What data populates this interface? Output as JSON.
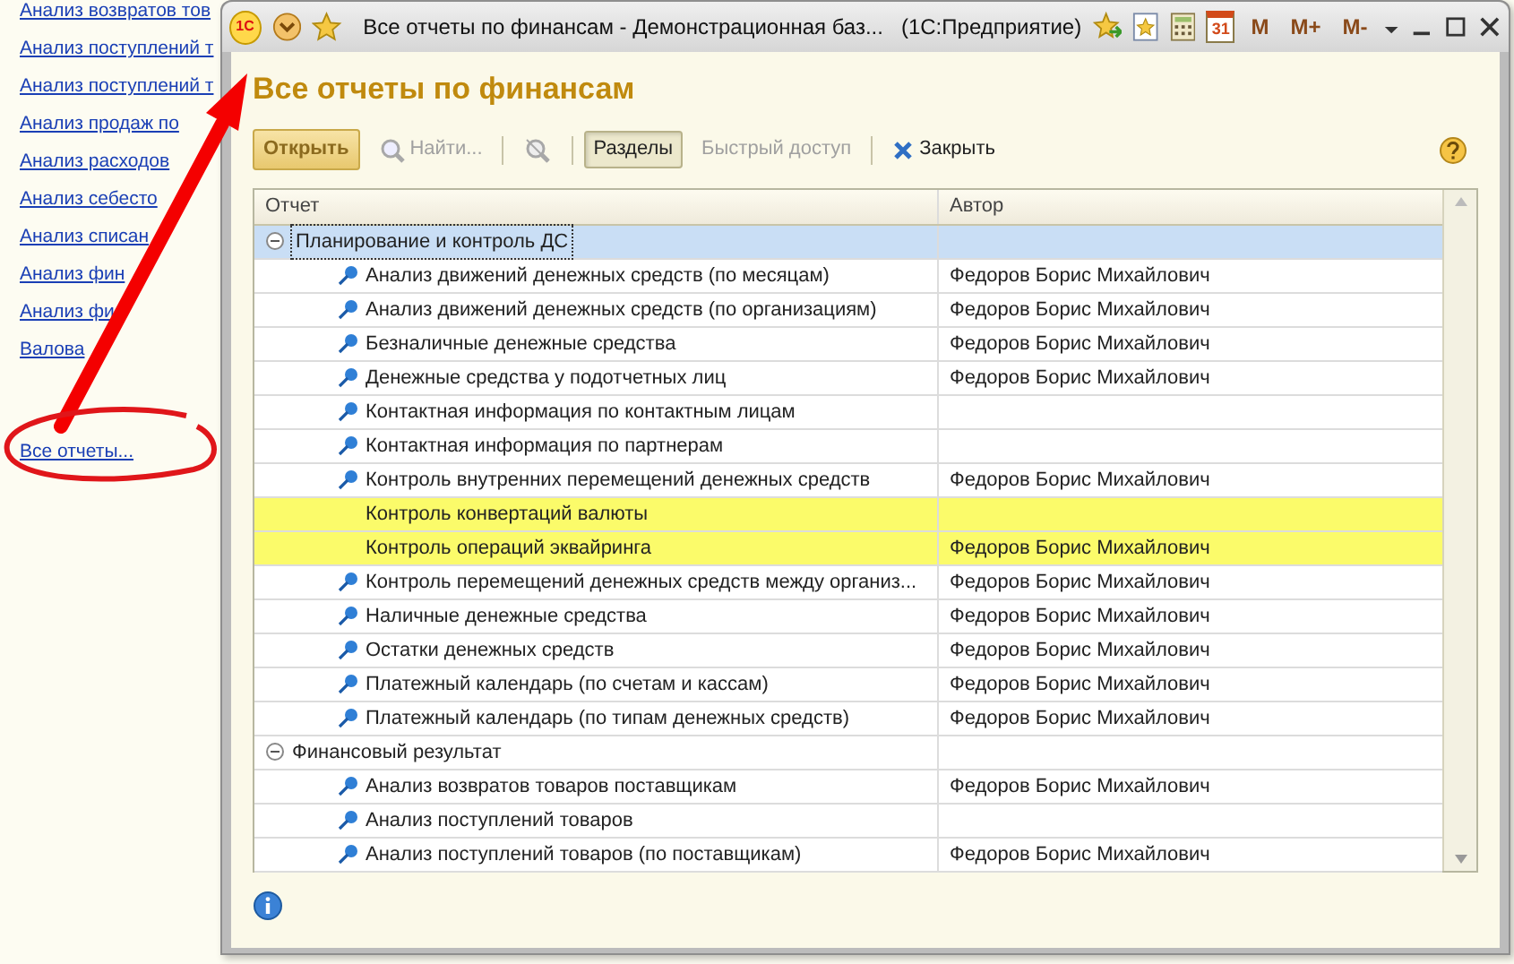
{
  "side_links": [
    {
      "text": "Анализ возвратов тов"
    },
    {
      "text": "Анализ поступлений т"
    },
    {
      "text": "Анализ поступлений т"
    },
    {
      "text": "Анализ продаж по"
    },
    {
      "text": "Анализ расходов"
    },
    {
      "text": "Анализ себесто"
    },
    {
      "text": "Анализ списан"
    },
    {
      "text": "Анализ фин"
    },
    {
      "text": "Анализ фи"
    },
    {
      "text": "Валова"
    }
  ],
  "all_reports_link": "Все отчеты...",
  "window": {
    "logo": "1С",
    "title": "Все отчеты по финансам - Демонстрационная баз...   (1С:Предприятие)",
    "calendar_day": "31",
    "memory_buttons": [
      "M",
      "M+",
      "M-"
    ]
  },
  "heading": "Все отчеты по финансам",
  "toolbar": [
    {
      "kind": "button",
      "label": "Открыть",
      "disabled": false,
      "pressed": false,
      "separator_before": false
    },
    {
      "kind": "find",
      "label": "Найти...",
      "disabled": true,
      "pressed": false,
      "separator_before": false
    },
    {
      "kind": "clear",
      "disabled": true,
      "pressed": false,
      "separator_before": true
    },
    {
      "kind": "toggle",
      "label": "Разделы",
      "disabled": false,
      "pressed": true,
      "separator_before": true
    },
    {
      "kind": "text",
      "label": "Быстрый доступ",
      "disabled": true,
      "pressed": false,
      "separator_before": false
    },
    {
      "kind": "close",
      "label": "Закрыть",
      "disabled": false,
      "pressed": false,
      "separator_before": true
    }
  ],
  "table": {
    "columns": [
      "Отчет",
      "Автор"
    ],
    "groups": [
      {
        "title": "Планирование и контроль ДС",
        "expanded": true,
        "selected": true,
        "children": [
          {
            "kind": "report",
            "title": "Анализ движений денежных средств (по месяцам)",
            "author": "Федоров Борис Михайлович",
            "highlighted": false,
            "selected": false
          },
          {
            "kind": "report",
            "title": "Анализ движений денежных средств (по организациям)",
            "author": "Федоров Борис Михайлович",
            "highlighted": false,
            "selected": false
          },
          {
            "kind": "report",
            "title": "Безналичные денежные средства",
            "author": "Федоров Борис Михайлович",
            "highlighted": false,
            "selected": false
          },
          {
            "kind": "report",
            "title": "Денежные средства у подотчетных лиц",
            "author": "Федоров Борис Михайлович",
            "highlighted": false,
            "selected": false
          },
          {
            "kind": "report",
            "title": "Контактная информация по контактным лицам",
            "highlighted": false,
            "selected": false
          },
          {
            "kind": "report",
            "title": "Контактная информация по партнерам",
            "highlighted": false,
            "selected": false
          },
          {
            "kind": "report",
            "title": "Контроль внутренних перемещений денежных средств",
            "author": "Федоров Борис Михайлович",
            "highlighted": false,
            "selected": false
          },
          {
            "kind": "custom",
            "title": "Контроль конвертаций валюты",
            "highlighted": true,
            "selected": false
          },
          {
            "kind": "custom",
            "title": "Контроль операций эквайринга",
            "author": "Федоров Борис Михайлович",
            "highlighted": true,
            "selected": false
          },
          {
            "kind": "report",
            "title": "Контроль перемещений денежных средств между организ...",
            "author": "Федоров Борис Михайлович",
            "highlighted": false,
            "selected": false
          },
          {
            "kind": "report",
            "title": "Наличные денежные средства",
            "author": "Федоров Борис Михайлович",
            "highlighted": false,
            "selected": false
          },
          {
            "kind": "report",
            "title": "Остатки денежных средств",
            "author": "Федоров Борис Михайлович",
            "highlighted": false,
            "selected": false
          },
          {
            "kind": "report",
            "title": "Платежный календарь (по счетам и кассам)",
            "author": "Федоров Борис Михайлович",
            "highlighted": false,
            "selected": false
          },
          {
            "kind": "report",
            "title": "Платежный календарь (по типам денежных средств)",
            "author": "Федоров Борис Михайлович",
            "highlighted": false,
            "selected": false
          }
        ]
      },
      {
        "title": "Финансовый результат",
        "expanded": true,
        "selected": false,
        "children": [
          {
            "kind": "report",
            "title": "Анализ возвратов товаров поставщикам",
            "author": "Федоров Борис Михайлович",
            "highlighted": false,
            "selected": false
          },
          {
            "kind": "report",
            "title": "Анализ поступлений товаров",
            "highlighted": false,
            "selected": false
          },
          {
            "kind": "report",
            "title": "Анализ поступлений товаров (по поставщикам)",
            "author": "Федоров Борис Михайлович",
            "highlighted": false,
            "selected": false
          }
        ]
      }
    ]
  }
}
